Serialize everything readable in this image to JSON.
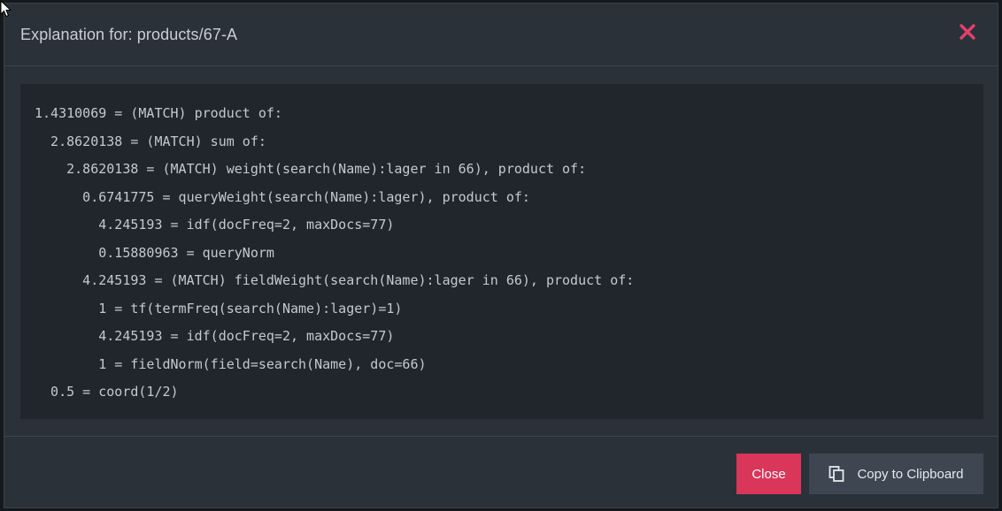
{
  "modal": {
    "title": "Explanation for: products/67-A",
    "close_icon": "close-x-icon",
    "accent_color": "#d9365a"
  },
  "explanation": {
    "lines": [
      "1.4310069 = (MATCH) product of:",
      "  2.8620138 = (MATCH) sum of:",
      "    2.8620138 = (MATCH) weight(search(Name):lager in 66), product of:",
      "      0.6741775 = queryWeight(search(Name):lager), product of:",
      "        4.245193 = idf(docFreq=2, maxDocs=77)",
      "        0.15880963 = queryNorm",
      "      4.245193 = (MATCH) fieldWeight(search(Name):lager in 66), product of:",
      "        1 = tf(termFreq(search(Name):lager)=1)",
      "        4.245193 = idf(docFreq=2, maxDocs=77)",
      "        1 = fieldNorm(field=search(Name), doc=66)",
      "  0.5 = coord(1/2)"
    ]
  },
  "footer": {
    "close_label": "Close",
    "copy_label": "Copy to Clipboard",
    "copy_icon": "copy-icon"
  }
}
